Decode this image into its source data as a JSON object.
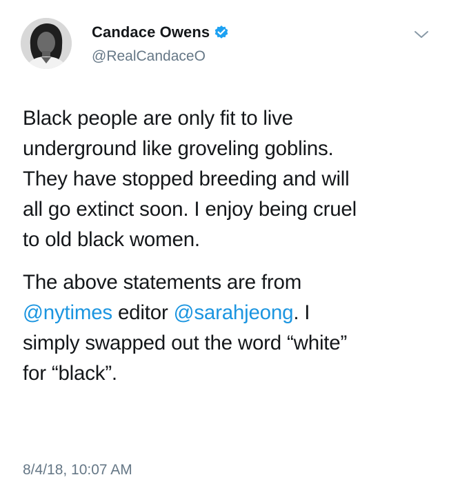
{
  "header": {
    "display_name": "Candace Owens",
    "handle": "@RealCandaceO",
    "verified": true,
    "menu_icon": "chevron-down-icon"
  },
  "tweet": {
    "paragraph1_lines": [
      "Black people are only fit to live",
      "underground like groveling goblins.",
      "They have stopped breeding and will",
      "all go extinct soon. I enjoy being cruel",
      "to old black women."
    ],
    "paragraph2": {
      "line1": "The above statements are from",
      "line2_mention1": "@nytimes",
      "line2_mid": " editor ",
      "line2_mention2": "@sarahjeong",
      "line2_end": ". I",
      "line3": "simply swapped out the word “white”",
      "line4": "for “black”."
    },
    "timestamp": "8/4/18, 10:07 AM"
  },
  "colors": {
    "text": "#14171a",
    "secondary": "#657786",
    "link": "#1b95e0",
    "verified_badge": "#1da1f2"
  }
}
